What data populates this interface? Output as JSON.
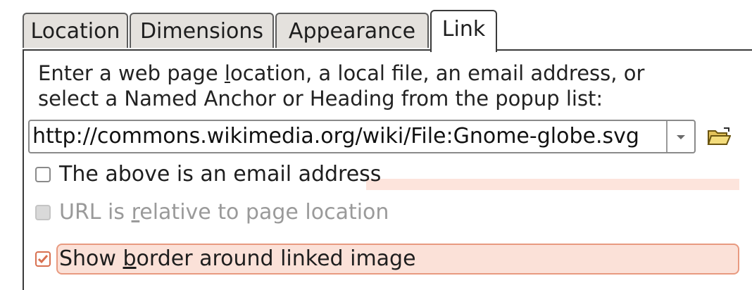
{
  "tabs": [
    {
      "label": "Location"
    },
    {
      "label": "Dimensions"
    },
    {
      "label": "Appearance"
    },
    {
      "label": "Link",
      "active": true
    }
  ],
  "link_tab": {
    "instruction_line1_pre": "Enter a web page ",
    "instruction_line1_mnemonic": "l",
    "instruction_line1_post": "ocation, a local file, an email address, or",
    "instruction_line2": "select a Named Anchor or Heading from the popup list:",
    "url_value": "http://commons.wikimedia.org/wiki/File:Gnome-globe.svg",
    "email_checkbox": {
      "label": "The above is an email address",
      "checked": false
    },
    "relative_checkbox": {
      "label_pre": "URL is ",
      "label_mnemonic": "r",
      "label_post": "elative to page location",
      "checked": false,
      "disabled": true
    },
    "border_checkbox": {
      "label_pre": "Show ",
      "label_mnemonic": "b",
      "label_post": "order around linked image",
      "checked": true
    }
  },
  "icons": {
    "dropdown": "chevron-down-icon",
    "folder": "open-folder-icon",
    "checkmark": "checkmark-icon"
  },
  "colors": {
    "accent": "#d87050",
    "focus_bg": "#fbe1d8"
  }
}
